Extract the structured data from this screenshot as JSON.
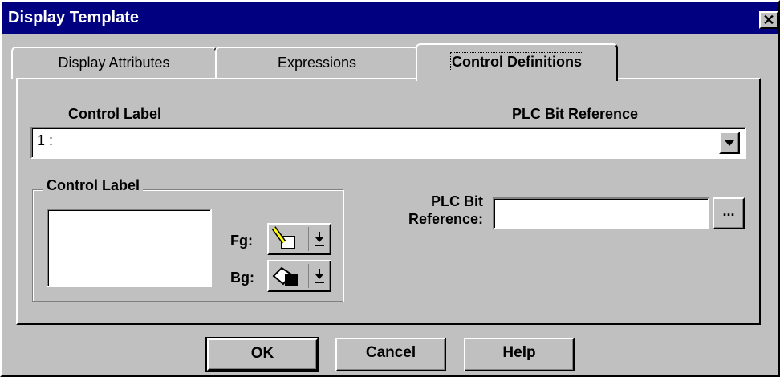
{
  "window": {
    "title": "Display Template",
    "close_glyph": "✕"
  },
  "tabs": [
    {
      "label": "Display Attributes",
      "active": false
    },
    {
      "label": "Expressions",
      "active": false
    },
    {
      "label": "Control Definitions",
      "active": true
    }
  ],
  "list_header": {
    "left": "Control Label",
    "right": "PLC Bit Reference"
  },
  "combo": {
    "value": "1 :",
    "arrow_icon": "dropdown-arrow-icon"
  },
  "control_label_group": {
    "legend": "Control Label",
    "text_value": "",
    "fg_label": "Fg:",
    "bg_label": "Bg:",
    "fg_icon": "pencil-icon",
    "bg_icon": "paint-bucket-icon",
    "dropdown_icon": "down-arrow-icon"
  },
  "plc": {
    "label_line1": "PLC Bit",
    "label_line2": "Reference:",
    "value": "",
    "browse_label": "..."
  },
  "buttons": {
    "ok": "OK",
    "cancel": "Cancel",
    "help": "Help"
  },
  "colors": {
    "title_bar": "#000080",
    "face": "#c0c0c0",
    "field": "#ffffff",
    "pencil": "#ffff00"
  }
}
